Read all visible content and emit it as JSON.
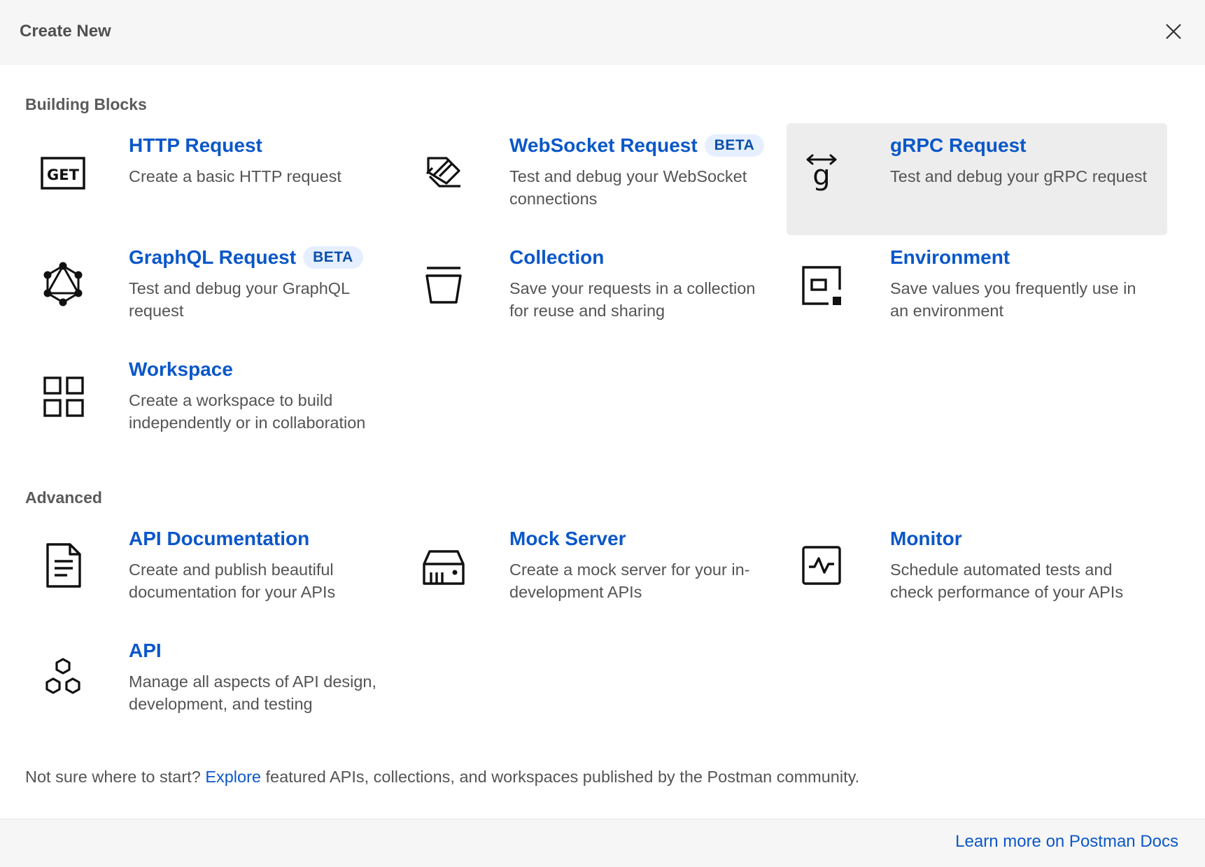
{
  "header": {
    "title": "Create New"
  },
  "sections": {
    "building_blocks": "Building Blocks",
    "advanced": "Advanced"
  },
  "cards": {
    "http": {
      "title": "HTTP Request",
      "desc": "Create a basic HTTP request",
      "icon_text": "GET"
    },
    "websocket": {
      "title": "WebSocket Request",
      "badge": "BETA",
      "desc": "Test and debug your WebSocket connections"
    },
    "grpc": {
      "title": "gRPC Request",
      "desc": "Test and debug your gRPC request",
      "icon_text": "g"
    },
    "graphql": {
      "title": "GraphQL Request",
      "badge": "BETA",
      "desc": "Test and debug your GraphQL request"
    },
    "collection": {
      "title": "Collection",
      "desc": "Save your requests in a collection for reuse and sharing"
    },
    "environment": {
      "title": "Environment",
      "desc": "Save values you frequently use in an environment"
    },
    "workspace": {
      "title": "Workspace",
      "desc": "Create a workspace to build independently or in collaboration"
    },
    "api_docs": {
      "title": "API Documentation",
      "desc": "Create and publish beautiful documentation for your APIs"
    },
    "mock_server": {
      "title": "Mock Server",
      "desc": "Create a mock server for your in-development APIs"
    },
    "monitor": {
      "title": "Monitor",
      "desc": "Schedule automated tests and check performance of your APIs"
    },
    "api": {
      "title": "API",
      "desc": "Manage all aspects of API design, development, and testing"
    }
  },
  "footer": {
    "prefix": "Not sure where to start?",
    "link": "Explore",
    "suffix": "featured APIs, collections, and workspaces published by the Postman community.",
    "docs_link": "Learn more on Postman Docs"
  },
  "colors": {
    "accent": "#0b57c9",
    "badge_bg": "#e6efff",
    "active_card_bg": "#ededed"
  }
}
